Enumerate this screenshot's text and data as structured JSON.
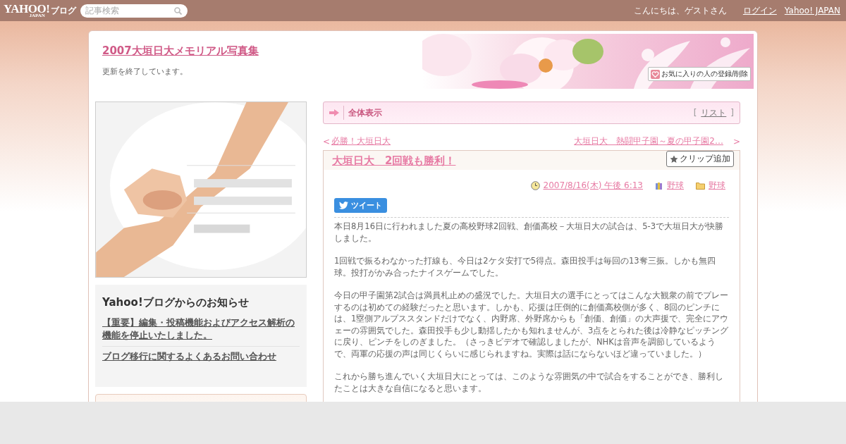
{
  "topbar": {
    "logo": "YAHOO!",
    "logo_sub": "JAPAN",
    "service": "ブログ",
    "search": {
      "placeholder": "記事検索"
    },
    "greeting": "こんにちは、ゲストさん",
    "links": [
      "ログイン",
      "Yahoo! JAPAN"
    ]
  },
  "blog": {
    "title": "2007大垣日大メモリアル写真集",
    "subtitle": "更新を終了しています。",
    "favorite_button": "お気に入りの人の登録/削除"
  },
  "sidebar": {
    "notice": {
      "title": "Yahoo!ブログからのお知らせ",
      "links": [
        "【重要】編集・投稿機能およびアクセス解析の機能を停止いたしました。",
        "ブログ移行に関するよくあるお問い合わせ"
      ]
    }
  },
  "view_bar": {
    "label": "全体表示",
    "link_open": "[",
    "link": "リスト",
    "link_close": "]"
  },
  "pager": {
    "prev_mark": "<",
    "prev": "必勝！大垣日大",
    "next": "大垣日大　熱闘甲子園～夏の甲子園2…",
    "next_mark": ">"
  },
  "article": {
    "title": "大垣日大　2回戦も勝利！",
    "clip_button": "クリップ追加",
    "date": "2007/8/16(木) 午後 6:13",
    "theme": "野球",
    "category": "野球",
    "tweet_button": "ツイート",
    "paragraphs": [
      "本日8月16日に行われました夏の高校野球2回戦、創価高校－大垣日大の試合は、5-3で大垣日大が快勝しました。",
      "1回戦で振るわなかった打線も、今日は2ケタ安打で5得点。森田投手は毎回の13奪三振。しかも無四球。投打がかみ合ったナイスゲームでした。",
      "今日の甲子園第2試合は満員札止めの盛況でした。大垣日大の選手にとってはこんな大観衆の前でプレーするのは初めての経験だったと思います。しかも、応援は圧倒的に創価高校側が多く、8回のピンチには、1塁側アルプススタンドだけでなく、内野席、外野席からも「創価、創価」の大声援で、完全にアウェーの雰囲気でした。森田投手も少し動揺したかも知れませんが、3点をとられた後は冷静なピッチングに戻り、ピンチをしのぎました。（さっきビデオで確認しましたが、NHKは音声を調節しているようで、両軍の応援の声は同じくらいに感じられますね。実際は話にならないほど違っていました。）",
      "これから勝ち進んでいく大垣日大にとっては、このような雰囲気の中で試合をすることができ、勝利したことは大きな自信になると思います。"
    ]
  }
}
